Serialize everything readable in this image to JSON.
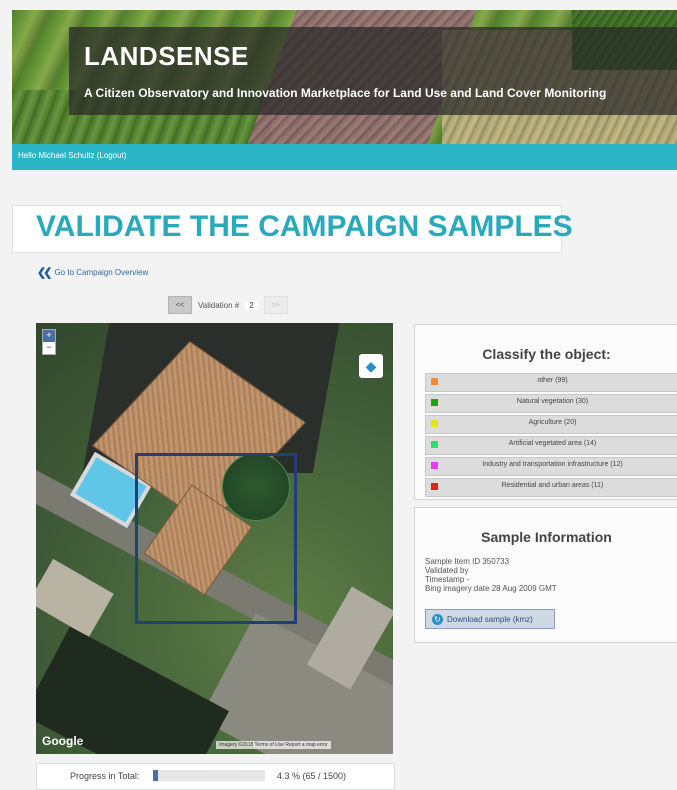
{
  "header": {
    "logo": "LANDSENSE",
    "subtitle": "A Citizen Observatory and Innovation Marketplace for Land Use and Land Cover Monitoring"
  },
  "userbar": {
    "greeting": "Hello Michael Schultz (Logout)"
  },
  "page": {
    "title": "VALIDATE THE CAMPAIGN SAMPLES"
  },
  "nav": {
    "back_link": "Go to Campaign Overview"
  },
  "validation": {
    "prev": "<<",
    "label": "Validation #",
    "number": "2",
    "next": ">>"
  },
  "map": {
    "zoom_in": "+",
    "zoom_out": "−",
    "provider": "Google",
    "attribution": "Imagery ©2018   Terms of Use   Report a map error"
  },
  "progress": {
    "label": "Progress in Total:",
    "fraction": 0.043,
    "text": "4.3 % (65 / 1500)"
  },
  "classify": {
    "title": "Classify the object:",
    "items": [
      {
        "label": "other (99)",
        "color": "#f28c3c"
      },
      {
        "label": "Natural vegetation (30)",
        "color": "#1aa31a"
      },
      {
        "label": "Agriculture (20)",
        "color": "#e6e60f"
      },
      {
        "label": "Artificial vegetated area (14)",
        "color": "#2ee06b"
      },
      {
        "label": "Industry and transportation infrastructure (12)",
        "color": "#e83be8"
      },
      {
        "label": "Residential and urban areas (11)",
        "color": "#e51f1f"
      }
    ]
  },
  "sample": {
    "title": "Sample Information",
    "item_id": "Sample Item ID 350733",
    "validated_by": "Validated by",
    "timestamp": "Timestamp -",
    "imagery_date": "Bing imagery date 28 Aug 2009 GMT",
    "download": "Download sample (kmz)"
  }
}
